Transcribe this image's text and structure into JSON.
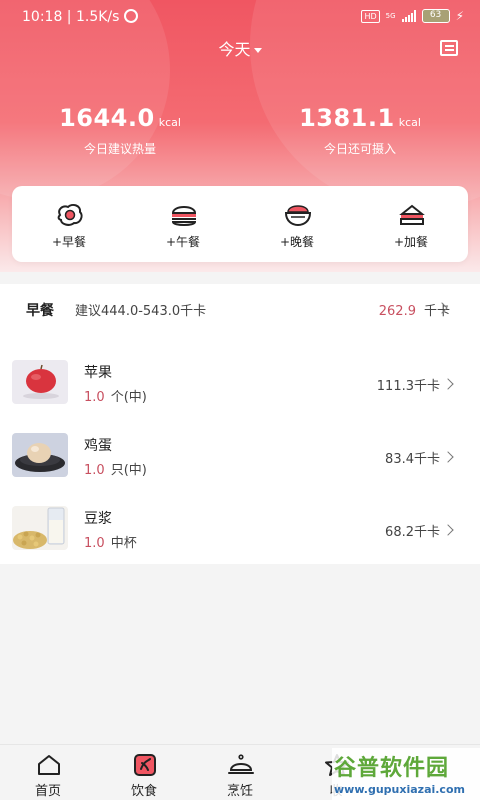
{
  "status_bar": {
    "time": "10:18 | 1.5K/s",
    "network": "HD",
    "signal": "5G",
    "battery": "63"
  },
  "header": {
    "day_label": "今天"
  },
  "stats": {
    "recommended": {
      "value": "1644.0",
      "unit": "kcal",
      "label": "今日建议热量"
    },
    "remaining": {
      "value": "1381.1",
      "unit": "kcal",
      "label": "今日还可摄入"
    }
  },
  "meal_buttons": [
    {
      "label": "+早餐",
      "icon": "fried-egg-icon"
    },
    {
      "label": "+午餐",
      "icon": "burger-icon"
    },
    {
      "label": "+晚餐",
      "icon": "rice-bowl-icon"
    },
    {
      "label": "+加餐",
      "icon": "sandwich-icon"
    }
  ],
  "breakfast": {
    "title": "早餐",
    "suggestion": "建议444.0-543.0千卡",
    "total_value": "262.9",
    "total_unit": "千卡",
    "items": [
      {
        "name": "苹果",
        "qty": "1.0",
        "unit": "个(中)",
        "kcal": "111.3千卡",
        "image": "apple-photo"
      },
      {
        "name": "鸡蛋",
        "qty": "1.0",
        "unit": "只(中)",
        "kcal": "83.4千卡",
        "image": "egg-photo"
      },
      {
        "name": "豆浆",
        "qty": "1.0",
        "unit": "中杯",
        "kcal": "68.2千卡",
        "image": "soy-milk-photo"
      }
    ]
  },
  "tabbar": {
    "tabs": [
      {
        "label": "首页",
        "icon": "home-icon"
      },
      {
        "label": "饮食",
        "icon": "diet-icon"
      },
      {
        "label": "烹饪",
        "icon": "cloche-icon"
      },
      {
        "label": "收",
        "icon": "star-icon"
      }
    ]
  },
  "watermark": {
    "text": "谷普软件园",
    "url": "www.gupuxiazai.com"
  },
  "colors": {
    "brand": "#f05662",
    "accent_value": "#c85060"
  }
}
